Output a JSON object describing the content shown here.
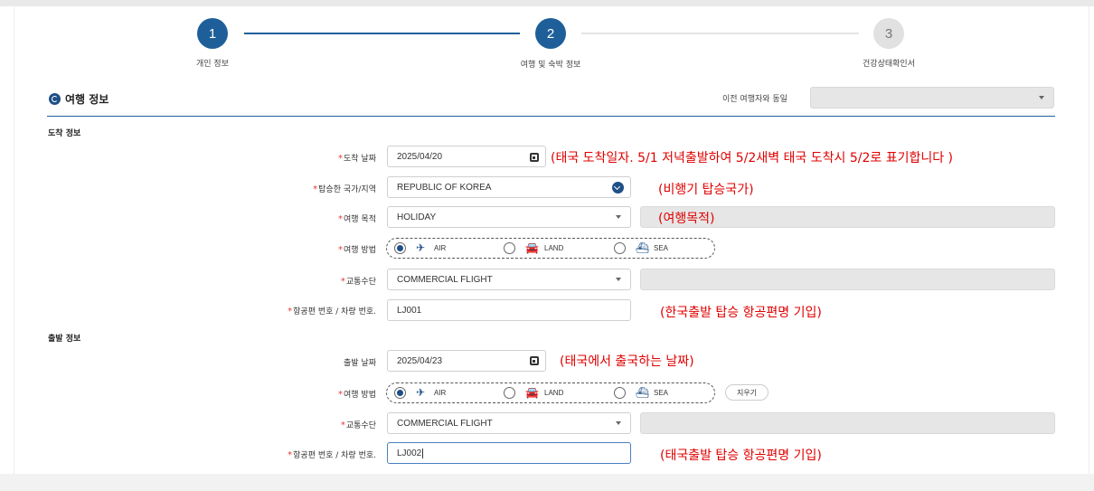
{
  "stepper": {
    "steps": [
      {
        "number": "1",
        "label": "개인 정보"
      },
      {
        "number": "2",
        "label": "여행 및 숙박 정보"
      },
      {
        "number": "3",
        "label": "건강상태확인서"
      }
    ],
    "active_step": 2
  },
  "section": {
    "title": "여행 정보",
    "icon": "globe-icon",
    "prev_traveler_label": "이전 여행자와 동일",
    "prev_traveler_value": ""
  },
  "arrival": {
    "title": "도착 정보",
    "date_label": "도착 날짜",
    "date_value": "2025/04/20",
    "date_note": "(태국 도착일자. 5/1 저녁출발하여 5/2새벽 태국 도착시 5/2로 표기합니다 )",
    "country_label": "탑승한 국가/지역",
    "country_value": "REPUBLIC OF KOREA",
    "country_note": "(비행기 탑승국가)",
    "purpose_label": "여행 목적",
    "purpose_value": "HOLIDAY",
    "purpose_note": "(여행목적)",
    "method_label": "여행 방법",
    "methods": [
      "AIR",
      "LAND",
      "SEA"
    ],
    "method_selected": "AIR",
    "transport_label": "교통수단",
    "transport_value": "COMMERCIAL FLIGHT",
    "flight_label": "항공편 번호 / 차량 번호.",
    "flight_value": "LJ001",
    "flight_note": "(한국출발 탑승 항공편명 기입)"
  },
  "departure": {
    "title": "출발 정보",
    "date_label": "출발 날짜",
    "date_value": "2025/04/23",
    "date_note": "(태국에서 출국하는 날짜)",
    "method_label": "여행 방법",
    "methods": [
      "AIR",
      "LAND",
      "SEA"
    ],
    "method_selected": "AIR",
    "clear_label": "지우기",
    "transport_label": "교통수단",
    "transport_value": "COMMERCIAL FLIGHT",
    "flight_label": "항공편 번호 / 차량 번호.",
    "flight_value": "LJ002",
    "flight_note": "(태국출발 탑승 항공편명 기입)"
  },
  "required_mark": "*",
  "colors": {
    "primary": "#1f5f99",
    "note": "#e00000",
    "required": "#e53935"
  }
}
